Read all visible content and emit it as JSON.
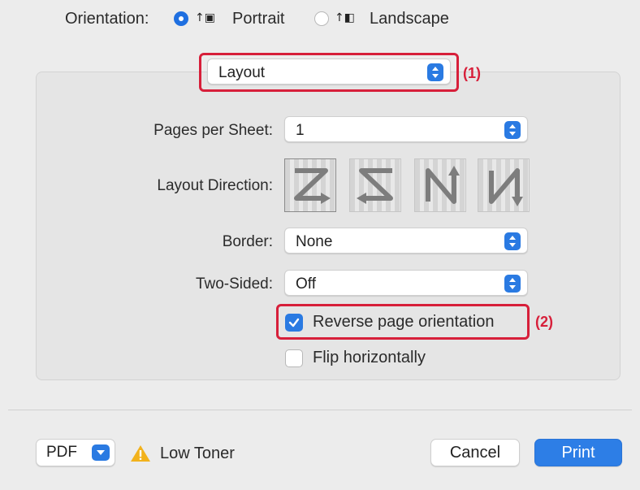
{
  "orientation": {
    "label": "Orientation:",
    "options": [
      {
        "label": "Portrait",
        "selected": true,
        "icon": "portrait-icon"
      },
      {
        "label": "Landscape",
        "selected": false,
        "icon": "landscape-icon"
      }
    ]
  },
  "section_menu": {
    "value": "Layout",
    "callout": "(1)"
  },
  "layout": {
    "pages_per_sheet": {
      "label": "Pages per Sheet:",
      "value": "1"
    },
    "layout_direction": {
      "label": "Layout Direction:",
      "options": [
        "Z",
        "reverse-Z",
        "N-reverse",
        "N"
      ]
    },
    "border": {
      "label": "Border:",
      "value": "None"
    },
    "two_sided": {
      "label": "Two-Sided:",
      "value": "Off"
    },
    "reverse_page_orientation": {
      "label": "Reverse page orientation",
      "checked": true,
      "callout": "(2)"
    },
    "flip_horizontally": {
      "label": "Flip horizontally",
      "checked": false
    }
  },
  "footer": {
    "pdf_label": "PDF",
    "warning": "Low Toner",
    "cancel_label": "Cancel",
    "print_label": "Print"
  },
  "colors": {
    "accent": "#2a7ae2",
    "callout": "#d71f3a",
    "warning": "#f2b21c"
  }
}
